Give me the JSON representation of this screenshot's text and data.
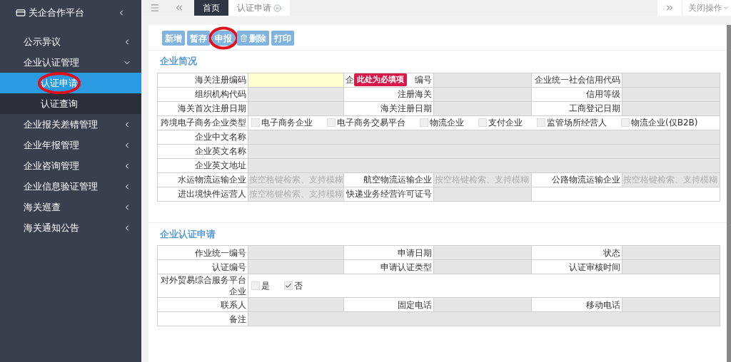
{
  "sidebar": {
    "title": "关企合作平台",
    "items": [
      {
        "label": "公示异议",
        "expanded": false
      },
      {
        "label": "企业认证管理",
        "expanded": true,
        "children": [
          {
            "label": "认证申请",
            "selected": true,
            "annotated": true
          },
          {
            "label": "认证查询",
            "selected": false,
            "annotated": false
          }
        ]
      },
      {
        "label": "企业报关差错管理",
        "expanded": false
      },
      {
        "label": "企业年报管理",
        "expanded": false
      },
      {
        "label": "企业咨询管理",
        "expanded": false
      },
      {
        "label": "企业信息验证管理",
        "expanded": false
      },
      {
        "label": "海关巡查",
        "expanded": false
      },
      {
        "label": "海关通知公告",
        "expanded": false
      }
    ]
  },
  "tabs": [
    {
      "label": "首页",
      "selected": true,
      "closable": false
    },
    {
      "label": "认证申请",
      "selected": false,
      "closable": true
    }
  ],
  "close_menu": "关闭操作",
  "toolbar": [
    {
      "label": "新增",
      "kind": "plain",
      "annotated": false
    },
    {
      "label": "暂存",
      "kind": "plain",
      "annotated": false
    },
    {
      "label": "申报",
      "kind": "plain",
      "annotated": true
    },
    {
      "label": "删除",
      "kind": "delete",
      "annotated": false
    },
    {
      "label": "打印",
      "kind": "plain",
      "annotated": false
    }
  ],
  "sections": [
    {
      "title": "企业简况",
      "rows": [
        [
          {
            "kind": "label",
            "text": "海关注册编码"
          },
          {
            "kind": "field",
            "required": true
          },
          {
            "kind": "label",
            "text": "编号",
            "prefix": "企",
            "tooltip": "此处为必填项"
          },
          {
            "kind": "field",
            "required": false
          },
          {
            "kind": "label",
            "text": "企业统一社会信用代码"
          },
          {
            "kind": "field",
            "required": false
          }
        ],
        [
          {
            "kind": "label",
            "text": "组织机构代码"
          },
          {
            "kind": "field",
            "required": false
          },
          {
            "kind": "label",
            "text": "注册海关"
          },
          {
            "kind": "field",
            "required": false
          },
          {
            "kind": "label",
            "text": "信用等级"
          },
          {
            "kind": "field",
            "required": false
          }
        ],
        [
          {
            "kind": "label",
            "text": "海关首次注册日期"
          },
          {
            "kind": "field",
            "required": false
          },
          {
            "kind": "label",
            "text": "海关注册日期"
          },
          {
            "kind": "field",
            "required": false
          },
          {
            "kind": "label",
            "text": "工商登记日期"
          },
          {
            "kind": "field",
            "required": false
          }
        ],
        [
          {
            "kind": "label",
            "text": "跨境电子商务企业类型"
          },
          {
            "kind": "checks",
            "options": [
              {
                "label": "电子商务企业",
                "checked": false
              },
              {
                "label": "电子商务交易平台",
                "checked": false
              },
              {
                "label": "物流企业",
                "checked": false
              },
              {
                "label": "支付企业",
                "checked": false
              },
              {
                "label": "监管场所经营人",
                "checked": false
              },
              {
                "label": "物流企业(仅B2B)",
                "checked": false
              }
            ]
          }
        ],
        [
          {
            "kind": "label",
            "text": "企业中文名称"
          },
          {
            "kind": "field",
            "required": false
          }
        ],
        [
          {
            "kind": "label",
            "text": "企业英文名称"
          },
          {
            "kind": "field",
            "required": false
          }
        ],
        [
          {
            "kind": "label",
            "text": "企业英文地址"
          },
          {
            "kind": "field",
            "required": false
          }
        ],
        [
          {
            "kind": "label",
            "text": "水运物流运输企业"
          },
          {
            "kind": "field",
            "required": false,
            "placeholder": "按空格键检索、支持模糊"
          },
          {
            "kind": "label",
            "text": "航空物流运输企业"
          },
          {
            "kind": "field",
            "required": false,
            "placeholder": "按空格键检索、支持模糊"
          },
          {
            "kind": "label",
            "text": "公路物流运输企业"
          },
          {
            "kind": "field",
            "required": false,
            "placeholder": "按空格键检索、支持模糊"
          }
        ],
        [
          {
            "kind": "label",
            "text": "进出境快件运营人"
          },
          {
            "kind": "field",
            "required": false,
            "placeholder": "按空格键检索、支持模糊"
          },
          {
            "kind": "label",
            "text": "快递业务经营许可证号"
          },
          {
            "kind": "field",
            "required": false
          },
          {
            "kind": "blank"
          }
        ]
      ]
    },
    {
      "title": "企业认证申请",
      "rows": [
        [
          {
            "kind": "label",
            "text": "作业统一编号"
          },
          {
            "kind": "field",
            "required": false
          },
          {
            "kind": "label",
            "text": "申请日期"
          },
          {
            "kind": "field",
            "required": false
          },
          {
            "kind": "label",
            "text": "状态"
          },
          {
            "kind": "field",
            "required": false
          }
        ],
        [
          {
            "kind": "label",
            "text": "认证编号"
          },
          {
            "kind": "field",
            "required": false
          },
          {
            "kind": "label",
            "text": "申请认证类型"
          },
          {
            "kind": "field",
            "required": false
          },
          {
            "kind": "label",
            "text": "认证审核时间"
          },
          {
            "kind": "field",
            "required": false
          }
        ],
        [
          {
            "kind": "label",
            "text": "对外贸易综合服务平台企业"
          },
          {
            "kind": "checks",
            "options": [
              {
                "label": "是",
                "checked": false
              },
              {
                "label": "否",
                "checked": true
              }
            ]
          }
        ],
        [
          {
            "kind": "label",
            "text": "联系人"
          },
          {
            "kind": "field",
            "required": false
          },
          {
            "kind": "label",
            "text": "固定电话"
          },
          {
            "kind": "field",
            "required": false
          },
          {
            "kind": "label",
            "text": "移动电话"
          },
          {
            "kind": "field",
            "required": false
          }
        ],
        [
          {
            "kind": "label",
            "text": "备注"
          },
          {
            "kind": "field",
            "required": false
          }
        ]
      ]
    }
  ]
}
